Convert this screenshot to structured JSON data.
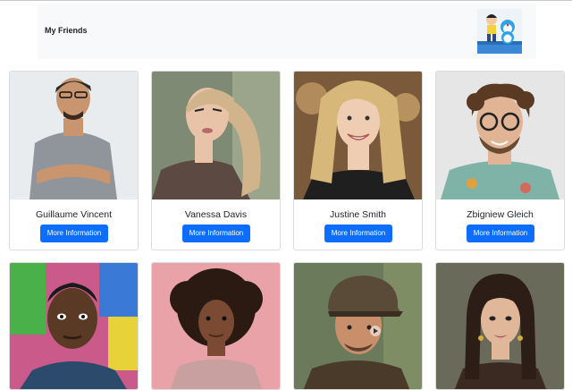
{
  "navbar": {
    "brand": "My Friends",
    "logo_icon": "doraemon-figures-icon"
  },
  "friends": [
    {
      "name": "Guillaume Vincent",
      "button": "More Information",
      "bg": "#e9ecef",
      "skin": "#c9956f",
      "hair": "#2b2b2b",
      "shirt": "#8f959b"
    },
    {
      "name": "Vanessa Davis",
      "button": "More Information",
      "bg": "#7f8a74",
      "skin": "#e8c3a8",
      "hair": "#d2b48c",
      "shirt": "#5c4a42"
    },
    {
      "name": "Justine Smith",
      "button": "More Information",
      "bg": "#7a5a3a",
      "skin": "#efcdb3",
      "hair": "#d8b77a",
      "shirt": "#1f1f1f"
    },
    {
      "name": "Zbigniew Gleich",
      "button": "More Information",
      "bg": "#e6e6e6",
      "skin": "#e2b496",
      "hair": "#5a3a22",
      "shirt": "#7fb3a8"
    },
    {
      "name": "",
      "button": "",
      "bg": "#c95a8a",
      "skin": "#5a3a24",
      "hair": "#1a1a1a",
      "shirt": "#2c4a6b"
    },
    {
      "name": "",
      "button": "",
      "bg": "#e9a3a8",
      "skin": "#7b4a32",
      "hair": "#2a1a12",
      "shirt": "#c9a0a0"
    },
    {
      "name": "",
      "button": "",
      "bg": "#6b7a5a",
      "skin": "#c88f6a",
      "hair": "#5a4a38",
      "shirt": "#4a3a2a"
    },
    {
      "name": "",
      "button": "",
      "bg": "#6a6a5a",
      "skin": "#e1b79a",
      "hair": "#2c1e16",
      "shirt": "#3a2a22"
    }
  ],
  "colors": {
    "accent": "#0d6efd",
    "navbar_bg": "#f8f9fa"
  }
}
